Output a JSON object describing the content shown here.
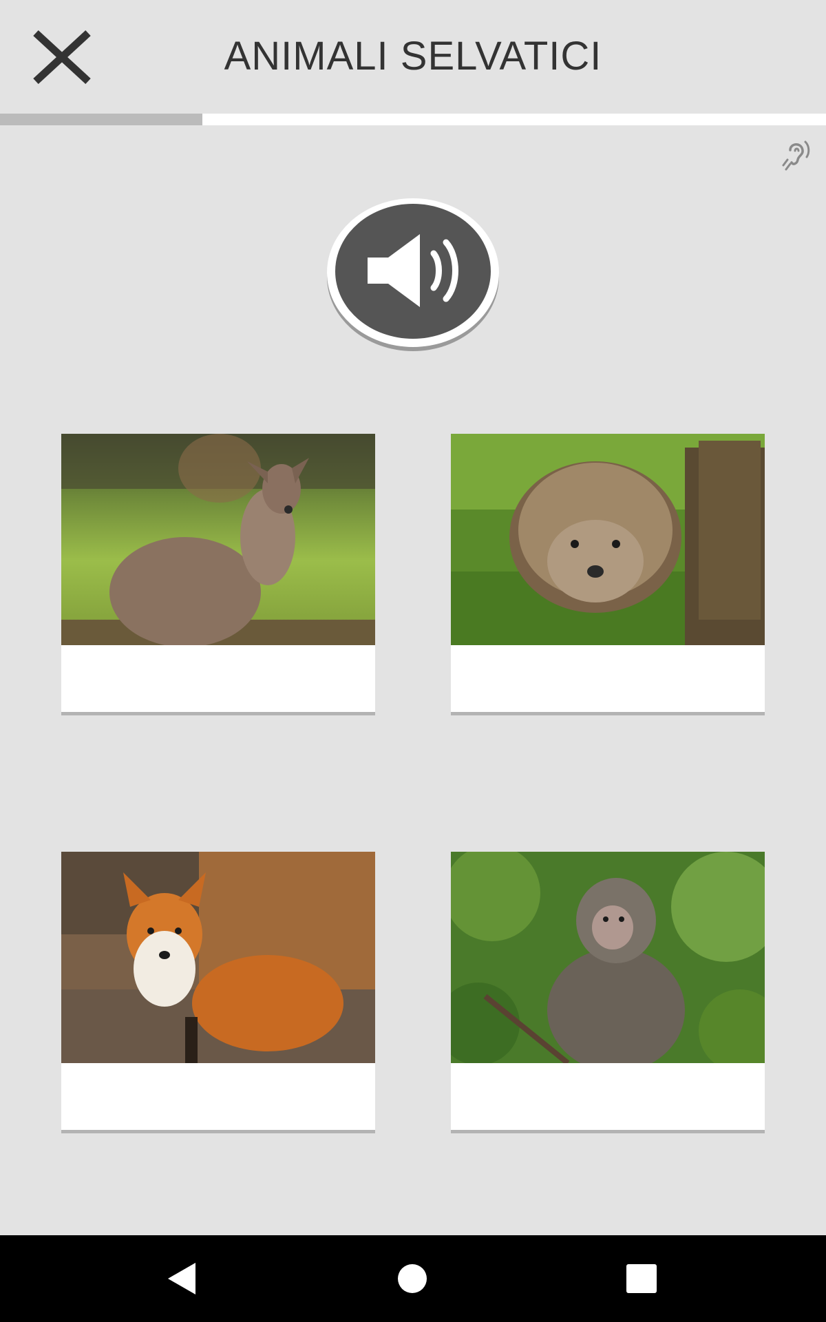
{
  "header": {
    "title": "ANIMALI SELVATICI",
    "close_icon": "close-icon"
  },
  "progress": {
    "value_fraction": 0.245
  },
  "toolbar": {
    "hearing_icon": "hearing-assist-icon",
    "speaker_icon": "speaker-volume-icon"
  },
  "cards": [
    {
      "image": "wallaby-photo",
      "caption": ""
    },
    {
      "image": "hedgehog-photo",
      "caption": ""
    },
    {
      "image": "fox-photo",
      "caption": ""
    },
    {
      "image": "macaque-photo",
      "caption": ""
    }
  ],
  "navbar": {
    "icons": [
      "back-icon",
      "home-icon",
      "recents-icon"
    ]
  },
  "colors": {
    "background": "#e3e3e3",
    "title_text": "#333333",
    "speaker_button": "#555555",
    "progress_fill": "#bbbbbb",
    "navbar": "#000000"
  }
}
